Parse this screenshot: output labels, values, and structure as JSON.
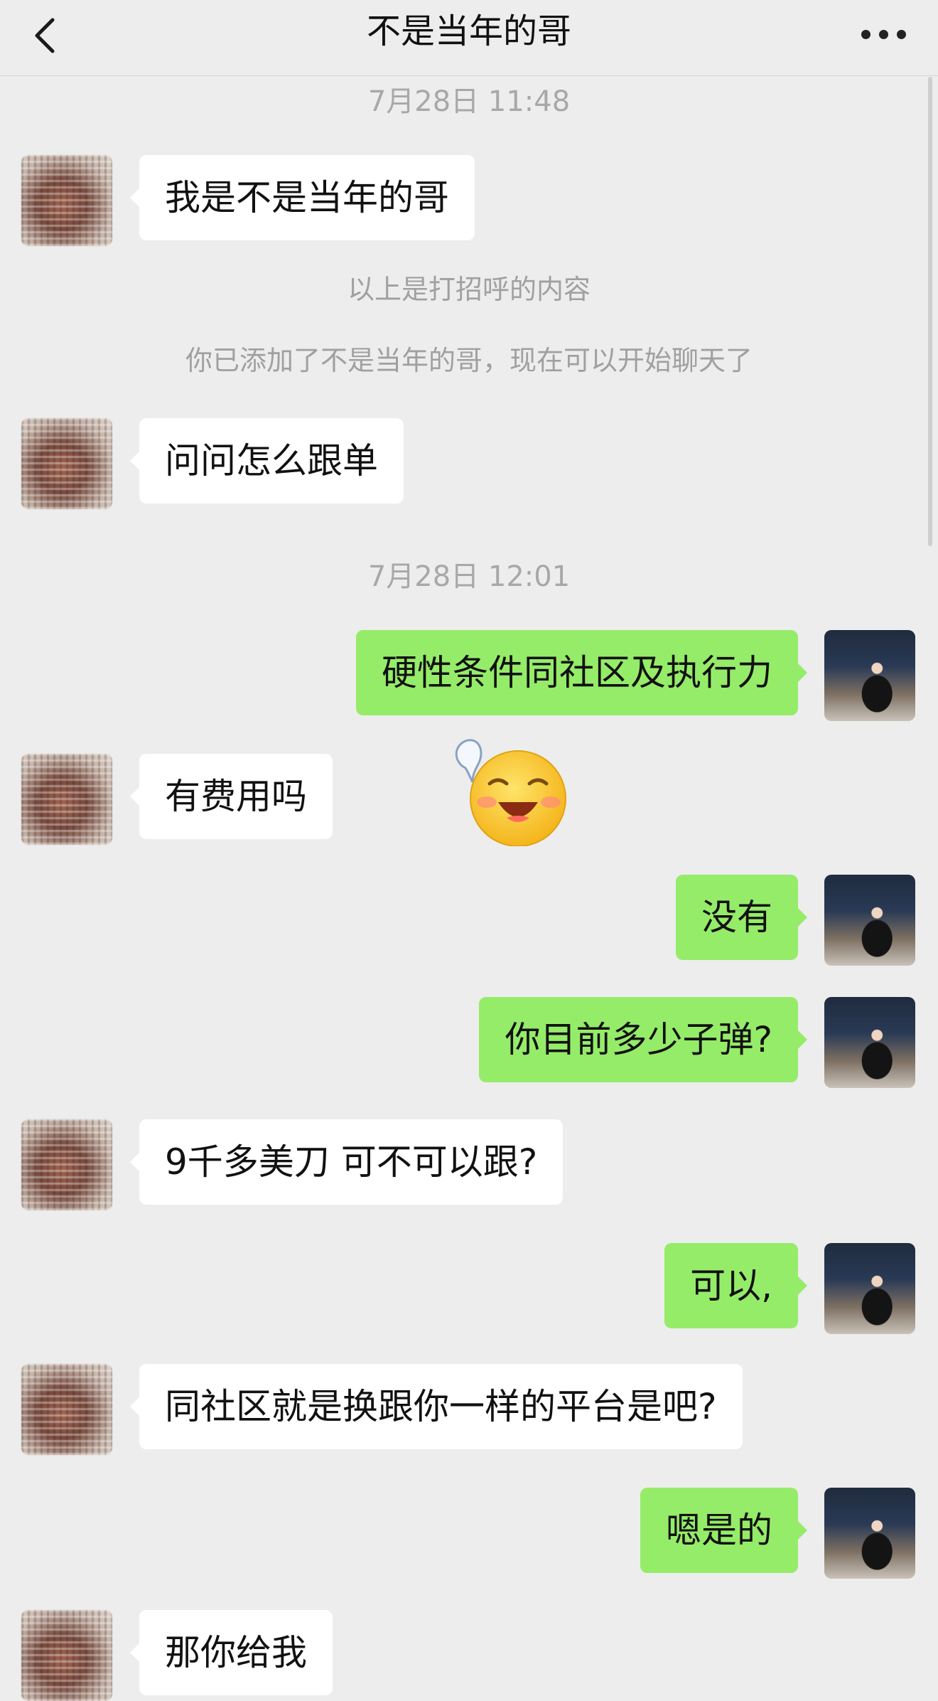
{
  "header": {
    "title": "不是当年的哥",
    "back_icon": "chevron-left-icon",
    "more_icon": "more-dots-icon"
  },
  "timestamps": [
    "7月28日 11:48",
    "7月28日 12:01"
  ],
  "system_messages": [
    "以上是打招呼的内容",
    "你已添加了不是当年的哥，现在可以开始聊天了"
  ],
  "messages": [
    {
      "side": "left",
      "text": "我是不是当年的哥"
    },
    {
      "side": "left",
      "text": "问问怎么跟单"
    },
    {
      "side": "right",
      "text": "硬性条件同社区及执行力"
    },
    {
      "side": "left",
      "text": "有费用吗"
    },
    {
      "side": "right",
      "text": "没有"
    },
    {
      "side": "right",
      "text": "你目前多少子弹?"
    },
    {
      "side": "left",
      "text": "9千多美刀 可不可以跟?"
    },
    {
      "side": "right",
      "text": "可以,"
    },
    {
      "side": "left",
      "text": "同社区就是换跟你一样的平台是吧?"
    },
    {
      "side": "right",
      "text": "嗯是的"
    },
    {
      "side": "left",
      "text": "那你给我"
    }
  ],
  "sticker": {
    "icon": "relieved-sweat-emoji-icon"
  },
  "colors": {
    "background": "#ededed",
    "incoming_bubble": "#ffffff",
    "outgoing_bubble": "#95ec69",
    "timestamp_text": "#a8a8a8"
  }
}
